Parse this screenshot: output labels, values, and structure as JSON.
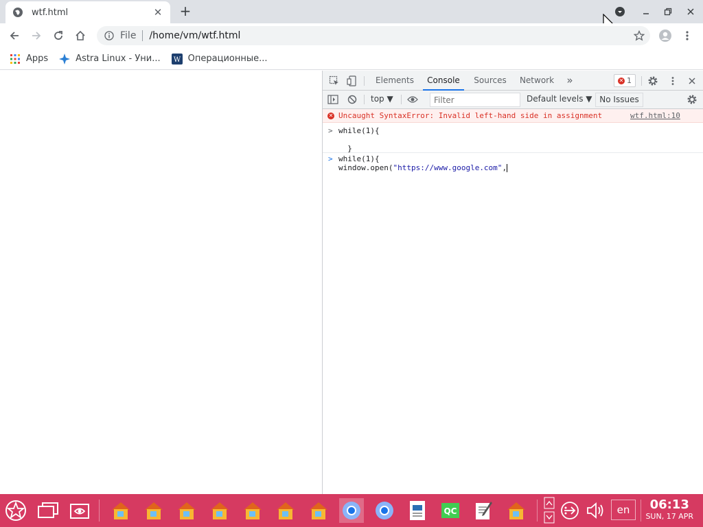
{
  "tab": {
    "title": "wtf.html",
    "close_label": "✕"
  },
  "newtab_label": "+",
  "omnibox": {
    "scheme": "File",
    "url": "/home/vm/wtf.html"
  },
  "bookmarks": [
    {
      "label": "Apps",
      "icon": "apps-grid-icon"
    },
    {
      "label": "Astra Linux - Уни...",
      "icon": "astra-star-icon"
    },
    {
      "label": "Операционные...",
      "icon": "w-logo-icon"
    }
  ],
  "devtools": {
    "tabs": [
      "Elements",
      "Console",
      "Sources",
      "Network"
    ],
    "active_tab": "Console",
    "more_label": "»",
    "error_count": "1",
    "context": "top ▼",
    "filter_placeholder": "Filter",
    "levels": "Default levels ▼",
    "issues": "No Issues"
  },
  "console": {
    "error_message": "Uncaught SyntaxError: Invalid left-hand side in assignment",
    "error_source": "wtf.html:10",
    "history_line1": "while(1){",
    "history_line2": "",
    "history_line3": "  }",
    "input_line1": "while(1){",
    "input_fn": "window.open(",
    "input_str": "\"https://www.google.com\"",
    "input_tail": ","
  },
  "taskbar": {
    "lang": "en",
    "time": "06:13",
    "date": "SUN, 17 APR"
  },
  "colors": {
    "taskbar": "#d63a61",
    "accent": "#1a73e8",
    "error": "#d93025"
  }
}
